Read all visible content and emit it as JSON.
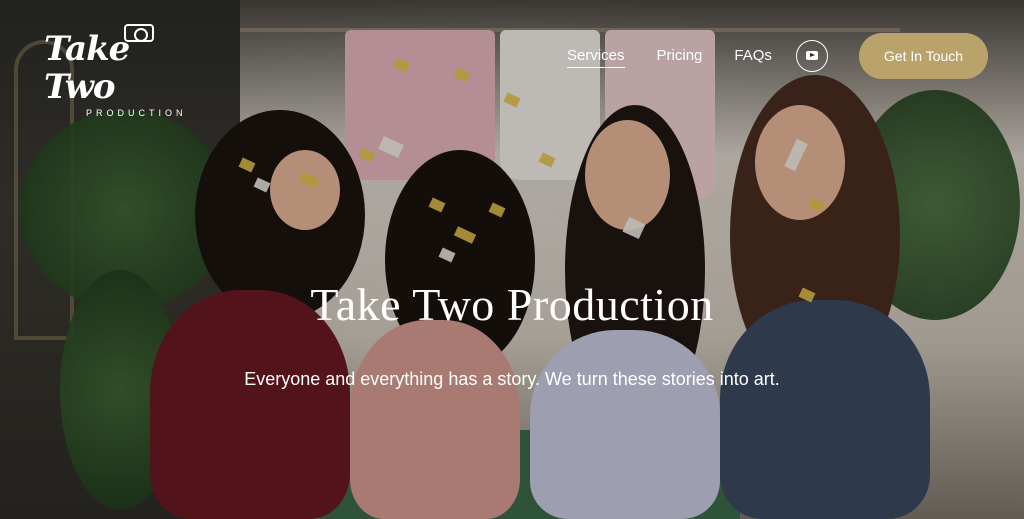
{
  "brand": {
    "logo_main": "Take Two",
    "logo_sub": "PRODUCTION"
  },
  "nav": {
    "items": [
      {
        "label": "Services",
        "active": true
      },
      {
        "label": "Pricing",
        "active": false
      },
      {
        "label": "FAQs",
        "active": false
      }
    ],
    "youtube_icon": "youtube-icon",
    "cta_label": "Get In Touch"
  },
  "hero": {
    "title": "Take Two Production",
    "subtitle": "Everyone and everything has a story. We turn these stories into art."
  },
  "colors": {
    "accent": "#b9a36b",
    "text": "#ffffff"
  }
}
